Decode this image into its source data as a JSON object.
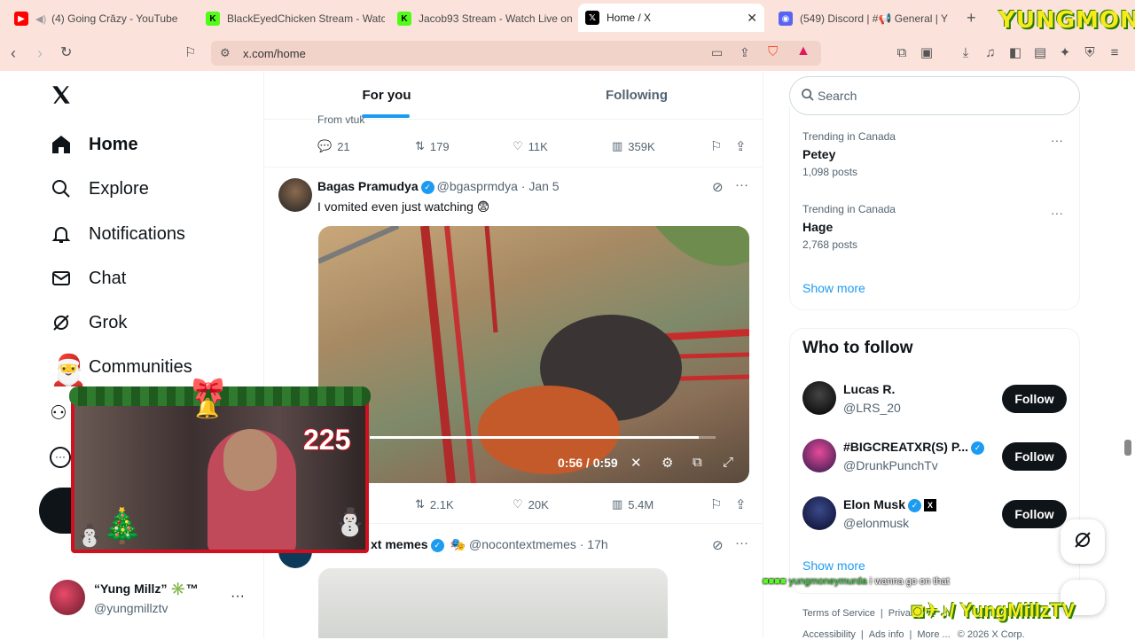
{
  "browser": {
    "tabs": [
      {
        "title": "(4) Going Crăzy - YouTube",
        "icon": "youtube-icon",
        "color": "#ff0000"
      },
      {
        "title": "BlackEyedChicken Stream - Watch",
        "icon": "kick-icon",
        "color": "#53fc18"
      },
      {
        "title": "Jacob93 Stream - Watch Live on K",
        "icon": "kick-icon",
        "color": "#53fc18"
      },
      {
        "title": "Home / X",
        "icon": "x-icon",
        "color": "#000000"
      },
      {
        "title": "(549) Discord | #📢 General | Y",
        "icon": "discord-icon",
        "color": "#5865f2"
      }
    ],
    "new_tab": "+",
    "url": "x.com/home"
  },
  "sidebar": {
    "items": [
      {
        "label": "Home",
        "icon": "home-icon"
      },
      {
        "label": "Explore",
        "icon": "search-icon"
      },
      {
        "label": "Notifications",
        "icon": "bell-icon"
      },
      {
        "label": "Chat",
        "icon": "mail-icon"
      },
      {
        "label": "Grok",
        "icon": "grok-icon"
      },
      {
        "label": "Communities",
        "icon": "communities-icon"
      }
    ],
    "account": {
      "name": "“Yung Millz” ✳️™",
      "handle": "@yungmillztv"
    }
  },
  "feed": {
    "tabs": [
      "For you",
      "Following"
    ],
    "prev_tweet": {
      "from": "From vtuk",
      "replies": "21",
      "retweets": "179",
      "likes": "11K",
      "views": "359K"
    },
    "tweet": {
      "name": "Bagas Pramudya",
      "handle": "@bgasprmdya",
      "time": "· Jan 5",
      "text": "I vomited even just watching 😨",
      "video_time": "0:56 / 0:59",
      "video_progress": 0.95,
      "retweets": "2.1K",
      "likes": "20K",
      "views": "5.4M"
    },
    "next_tweet": {
      "name": "xt memes",
      "handle": "@nocontextmemes",
      "time": "· 17h"
    }
  },
  "right": {
    "search_placeholder": "Search",
    "trends": [
      {
        "context": "Trending in Canada",
        "name": "Petey",
        "posts": "1,098 posts"
      },
      {
        "context": "Trending in Canada",
        "name": "Hage",
        "posts": "2,768 posts"
      }
    ],
    "show_more": "Show more",
    "who_to_follow": {
      "title": "Who to follow",
      "users": [
        {
          "name": "Lucas R.",
          "handle": "@LRS_20",
          "button": "Follow"
        },
        {
          "name": "#BIGCREATXR(S) P...",
          "handle": "@DrunkPunchTv",
          "button": "Follow"
        },
        {
          "name": "Elon Musk",
          "handle": "@elonmusk",
          "button": "Follow"
        }
      ],
      "show_more": "Show more"
    },
    "footer": [
      "Terms of Service",
      "Priva",
      "Accessibility",
      "Ads info",
      "More ...",
      "© 2026 X Corp."
    ]
  },
  "overlay": {
    "brand": "YUNGMONEY",
    "counter": "225",
    "chat_user": "yungmoneymurda",
    "chat_msg": "i wanna go on that",
    "socials": "/ YungMillzTV"
  },
  "colors": {
    "accent": "#1d9bf0",
    "tab_strip": "#fbe3dc",
    "overlay_red": "#d10f1f"
  }
}
